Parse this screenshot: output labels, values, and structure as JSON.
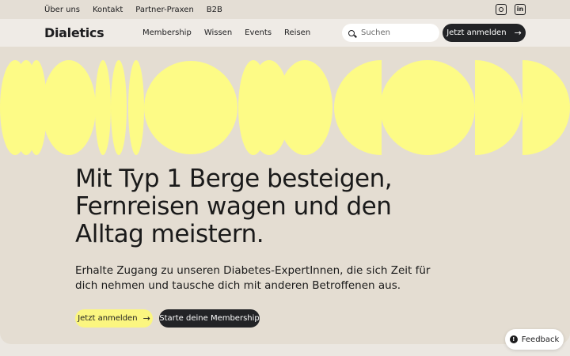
{
  "topbar": {
    "links": [
      "Über uns",
      "Kontakt",
      "Partner-Praxen",
      "B2B"
    ],
    "social": [
      "instagram-icon",
      "linkedin-icon"
    ]
  },
  "navbar": {
    "logo": "Dialetics",
    "items": [
      "Membership",
      "Wissen",
      "Events",
      "Reisen"
    ],
    "search_placeholder": "Suchen",
    "cta_label": "Jetzt anmelden"
  },
  "hero": {
    "headline": "Mit Typ 1 Berge besteigen, Fernreisen wagen und den Alltag meistern.",
    "subtext": "Erhalte Zugang zu unseren Diabetes-ExpertInnen, die sich Zeit für dich nehmen und tausche dich mit anderen Betroffenen aus.",
    "primary_button": "Jetzt anmelden",
    "secondary_button": "Starte deine Membership"
  },
  "feedback_label": "Feedback",
  "colors": {
    "accent_yellow": "#fbf680",
    "shape_yellow": "#fdfb86",
    "dark": "#222326",
    "hero_bg": "#e4ddd2"
  }
}
